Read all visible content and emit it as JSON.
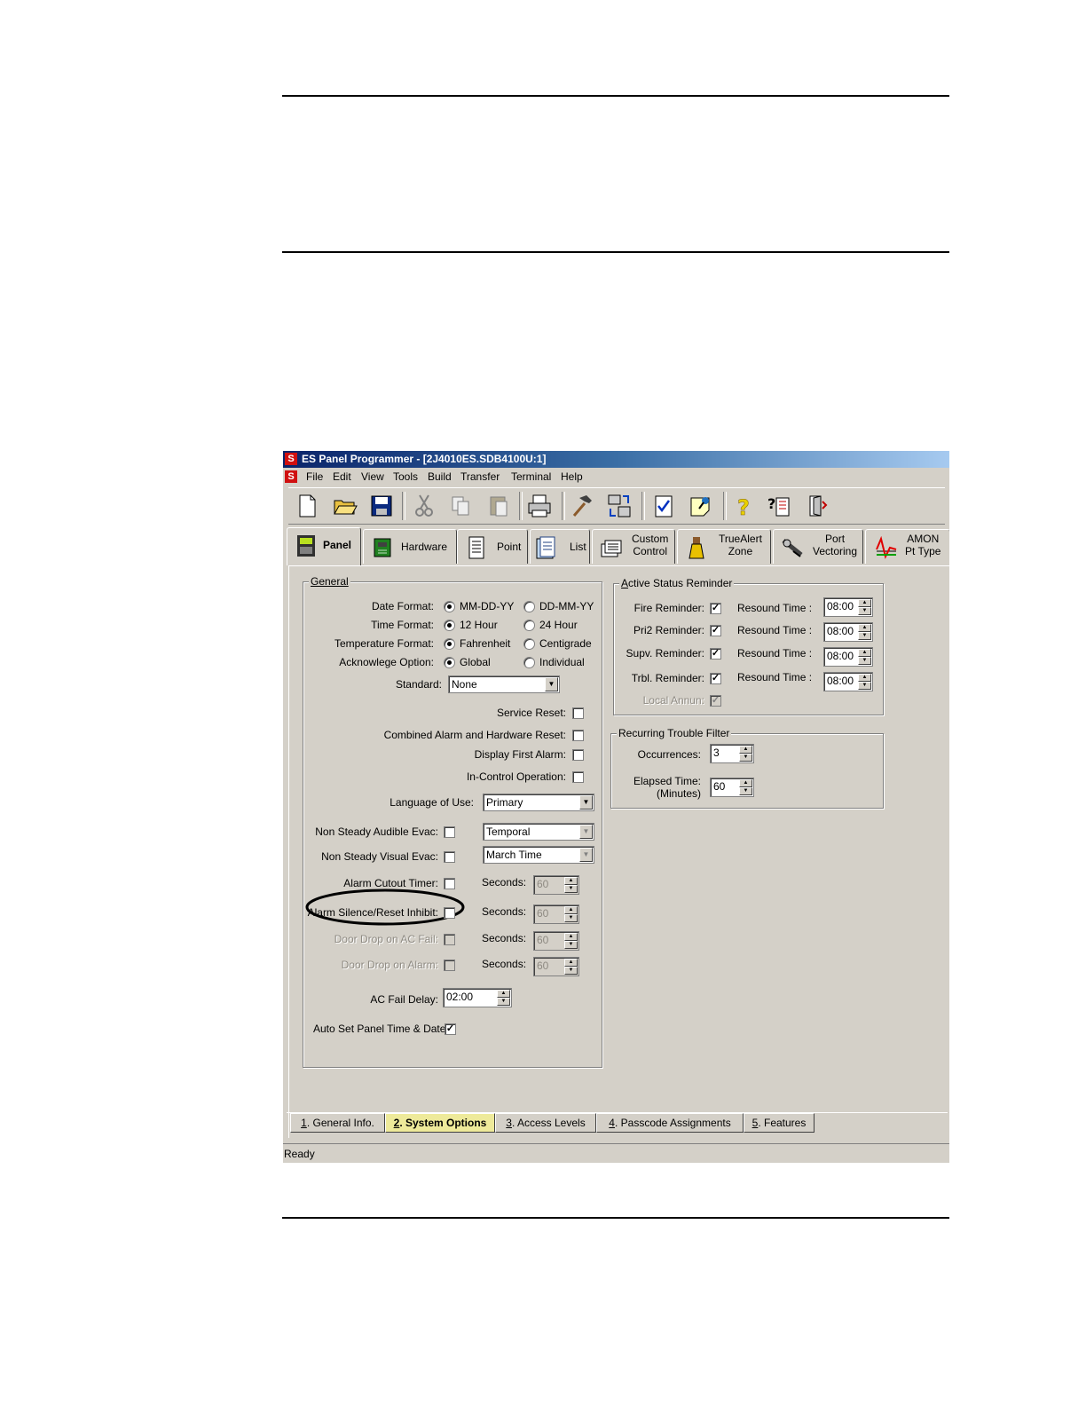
{
  "window": {
    "title": "ES Panel Programmer - [2J4010ES.SDB4100U:1]",
    "menu": [
      "File",
      "Edit",
      "View",
      "Tools",
      "Build",
      "Transfer",
      "Terminal",
      "Help"
    ]
  },
  "toolbar": {
    "icons": [
      "new-document-icon",
      "open-folder-icon",
      "save-icon",
      "cut-icon",
      "copy-icon",
      "paste-icon",
      "print-icon",
      "build-hammer-icon",
      "transfer-icon",
      "checklist-icon",
      "pushpin-note-icon",
      "help-icon",
      "context-help-icon",
      "exit-door-icon"
    ]
  },
  "tabs": [
    {
      "label": "Panel"
    },
    {
      "label": "Hardware"
    },
    {
      "label": "Point"
    },
    {
      "label": "List"
    },
    {
      "label1": "Custom",
      "label2": "Control"
    },
    {
      "label1": "TrueAlert",
      "label2": "Zone"
    },
    {
      "label1": "Port",
      "label2": "Vectoring"
    },
    {
      "label1": "AMON",
      "label2": "Pt Type"
    }
  ],
  "general": {
    "legend": "General",
    "date_format": {
      "label": "Date Format:",
      "opt1": "MM-DD-YY",
      "opt2": "DD-MM-YY",
      "selected": "MM-DD-YY"
    },
    "time_format": {
      "label": "Time Format:",
      "opt1": "12 Hour",
      "opt2": "24 Hour",
      "selected": "12 Hour"
    },
    "temperature_format": {
      "label": "Temperature Format:",
      "opt1": "Fahrenheit",
      "opt2": "Centigrade",
      "selected": "Fahrenheit"
    },
    "acknowledge_option": {
      "label": "Acknowlege Option:",
      "opt1": "Global",
      "opt2": "Individual",
      "selected": "Global"
    },
    "standard": {
      "label": "Standard:",
      "value": "None"
    },
    "service_reset": {
      "label": "Service Reset:",
      "checked": false
    },
    "combined_reset": {
      "label": "Combined Alarm and Hardware Reset:",
      "checked": false
    },
    "display_first_alarm": {
      "label": "Display First Alarm:",
      "checked": false
    },
    "in_control": {
      "label": "In-Control Operation:",
      "checked": false
    },
    "language": {
      "label": "Language of Use:",
      "value": "Primary"
    },
    "audible_evac": {
      "label": "Non Steady Audible Evac:",
      "checked": false,
      "value": "Temporal"
    },
    "visual_evac": {
      "label": "Non Steady Visual Evac:",
      "checked": false,
      "value": "March Time"
    },
    "seconds_label": "Seconds:",
    "alarm_cutout": {
      "label": "Alarm Cutout Timer:",
      "checked": false,
      "seconds": "60"
    },
    "silence_inhibit": {
      "label": "Alarm Silence/Reset Inhibit:",
      "checked": false,
      "seconds": "60"
    },
    "door_drop_ac": {
      "label": "Door Drop on AC Fail:",
      "checked": false,
      "seconds": "60"
    },
    "door_drop_alarm": {
      "label": "Door Drop on Alarm:",
      "checked": false,
      "seconds": "60"
    },
    "ac_fail_delay": {
      "label": "AC Fail Delay:",
      "value": "02:00"
    },
    "auto_set_time": {
      "label": "Auto Set Panel Time & Date",
      "checked": true
    }
  },
  "active_status": {
    "legend": "Active Status Reminder",
    "resound_label": "Resound Time :",
    "rows": [
      {
        "label": "Fire Reminder:",
        "checked": true,
        "time": "08:00"
      },
      {
        "label": "Pri2 Reminder:",
        "checked": true,
        "time": "08:00"
      },
      {
        "label": "Supv. Reminder:",
        "checked": true,
        "time": "08:00"
      },
      {
        "label": "Trbl. Reminder:",
        "checked": true,
        "time": "08:00"
      }
    ],
    "local_annun": {
      "label": "Local Annun:",
      "checked": true
    }
  },
  "trouble_filter": {
    "legend": "Recurring Trouble Filter",
    "occurrences": {
      "label": "Occurrences:",
      "value": "3"
    },
    "elapsed": {
      "label1": "Elapsed Time:",
      "label2": "(Minutes)",
      "value": "60"
    }
  },
  "bottom_tabs": [
    {
      "num": "1",
      "label": ". General Info."
    },
    {
      "num": "2",
      "label": ". System Options"
    },
    {
      "num": "3",
      "label": ". Access Levels"
    },
    {
      "num": "4",
      "label": ". Passcode Assignments"
    },
    {
      "num": "5",
      "label": ". Features"
    }
  ],
  "status": "Ready"
}
